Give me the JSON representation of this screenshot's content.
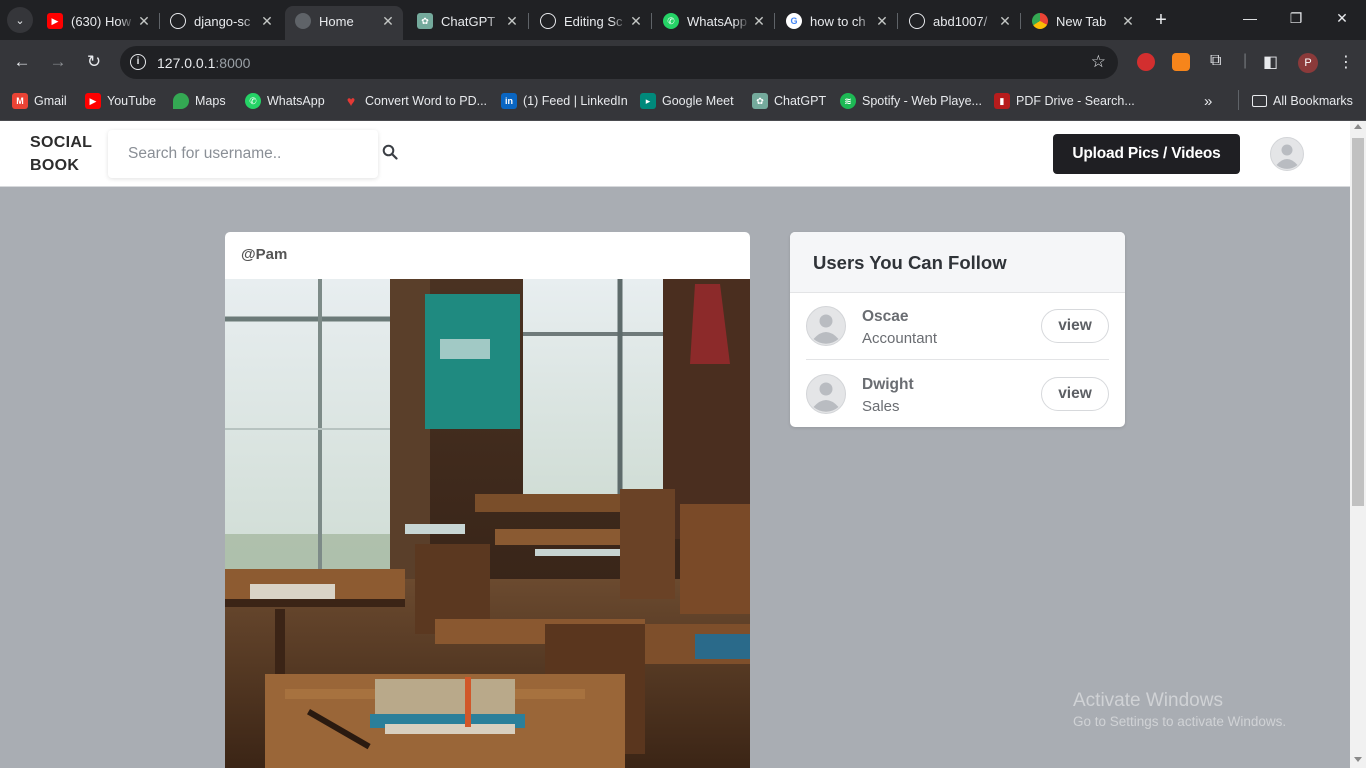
{
  "browser": {
    "tabs": [
      {
        "title": "(630) How",
        "icon": "youtube-icon",
        "color": "#ff0000"
      },
      {
        "title": "django-sc",
        "icon": "github-icon",
        "color": "#202124"
      },
      {
        "title": "Home",
        "icon": "globe-icon",
        "color": "#5f6368",
        "active": true
      },
      {
        "title": "ChatGPT",
        "icon": "chatgpt-icon",
        "color": "#74aa9c"
      },
      {
        "title": "Editing Sc",
        "icon": "github-icon",
        "color": "#202124"
      },
      {
        "title": "WhatsApp",
        "icon": "whatsapp-icon",
        "color": "#25d366"
      },
      {
        "title": "how to ch",
        "icon": "google-icon",
        "color": "#ffffff"
      },
      {
        "title": "abd1007/",
        "icon": "github-icon",
        "color": "#202124"
      },
      {
        "title": "New Tab",
        "icon": "chrome-icon",
        "color": "#ffffff"
      }
    ],
    "url_host": "127.0.0.1",
    "url_port": ":8000",
    "profile_initial": "P",
    "bookmarks": [
      {
        "label": "Gmail",
        "icon": "gmail-icon",
        "color": "#ea4335"
      },
      {
        "label": "YouTube",
        "icon": "youtube-icon",
        "color": "#ff0000"
      },
      {
        "label": "Maps",
        "icon": "maps-icon",
        "color": "#34a853"
      },
      {
        "label": "WhatsApp",
        "icon": "whatsapp-icon",
        "color": "#25d366"
      },
      {
        "label": "Convert Word to PD...",
        "icon": "heart-icon",
        "color": "#e53935"
      },
      {
        "label": "(1) Feed | LinkedIn",
        "icon": "linkedin-icon",
        "color": "#0a66c2"
      },
      {
        "label": "Google Meet",
        "icon": "meet-icon",
        "color": "#00897b"
      },
      {
        "label": "ChatGPT",
        "icon": "chatgpt-icon",
        "color": "#74aa9c"
      },
      {
        "label": "Spotify - Web Playe...",
        "icon": "spotify-icon",
        "color": "#1db954"
      },
      {
        "label": "PDF Drive - Search...",
        "icon": "pdf-icon",
        "color": "#b71c1c"
      }
    ],
    "all_bookmarks": "All Bookmarks"
  },
  "site": {
    "logo_line1": "SOCIAL",
    "logo_line2": "BOOK",
    "search_placeholder": "Search for username..",
    "upload_label": "Upload Pics / Videos"
  },
  "post": {
    "username": "@Pam",
    "image": "classroom-photo"
  },
  "follow": {
    "title": "Users You Can Follow",
    "users": [
      {
        "name": "Oscae",
        "role": "Accountant",
        "button": "view"
      },
      {
        "name": "Dwight",
        "role": "Sales",
        "button": "view"
      }
    ]
  },
  "watermark": {
    "line1": "Activate Windows",
    "line2": "Go to Settings to activate Windows."
  },
  "colors": {
    "page_bg": "#a9adb3",
    "upload_button": "#1f1f23",
    "chrome_dark": "#202124"
  }
}
